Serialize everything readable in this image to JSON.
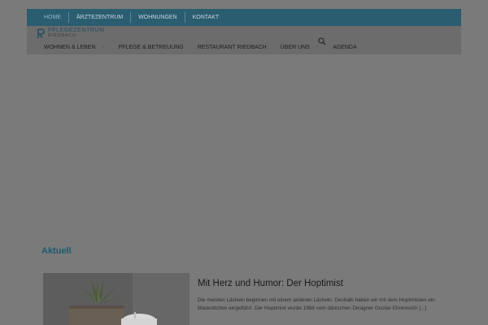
{
  "topnav": {
    "items": [
      "HOME",
      "ÄRZTEZENTRUM",
      "WOHNUNGEN",
      "KONTAKT"
    ]
  },
  "logo": {
    "line1": "PFLEGEZENTRUM",
    "line2": "RIEDBACH"
  },
  "mainnav": {
    "items": [
      {
        "label": "WOHNEN & LEBEN",
        "has_submenu": true
      },
      {
        "label": "PFLEGE & BETREUUNG",
        "has_submenu": false
      },
      {
        "label": "RESTAURANT RIEDBACH",
        "has_submenu": false
      },
      {
        "label": "ÜBER UNS",
        "has_submenu": true
      },
      {
        "label": "AGENDA",
        "has_submenu": false
      }
    ]
  },
  "icons": {
    "search": "search-icon",
    "submenu": "chevron-down-icon"
  },
  "colors": {
    "topbar": "#2a5d70",
    "accent": "#1f5a70",
    "overlay_bg": "#7a7a7a"
  },
  "news": {
    "section_title": "Aktuell",
    "article": {
      "title": "Mit Herz und Humor: Der Hoptimist",
      "excerpt": "Die meisten Lächeln beginnen mit einem anderen Lächeln. Deshalb haben wir mit dem Hoptimisten ein Maskottchen eingeführt. Der Hoptimist wurde 1968 vom dänischen Designer Gustav Ehrenreich [...]"
    }
  }
}
